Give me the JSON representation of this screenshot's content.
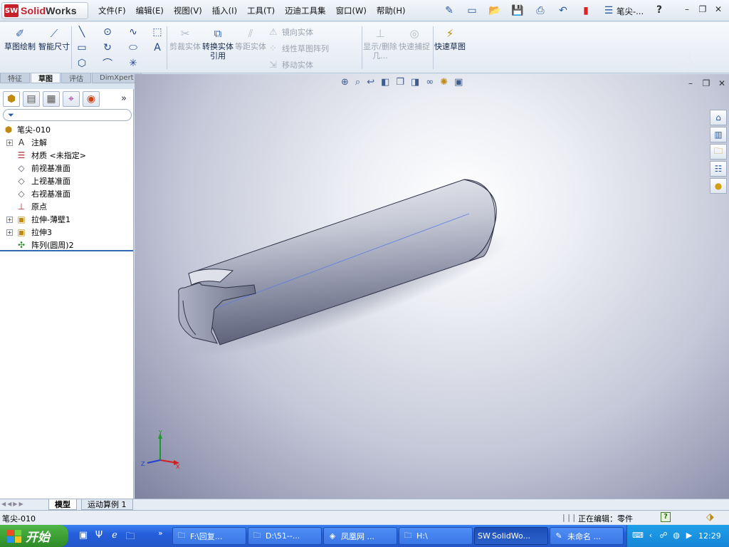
{
  "app": {
    "brand_prefix": "Solid",
    "brand_suffix": "Works",
    "logo_badge": "SW",
    "doc_title": "笔尖-..."
  },
  "menus": [
    "文件(F)",
    "编辑(E)",
    "视图(V)",
    "插入(I)",
    "工具(T)",
    "迈迪工具集",
    "窗口(W)",
    "帮助(H)"
  ],
  "commands": {
    "sketch": "草图绘制",
    "smart_dim": "智能尺寸",
    "trim": "剪裁实体",
    "convert": "转换实体引用",
    "offset": "等距实体",
    "mirror": "镜向实体",
    "linear_pattern": "线性草图阵列",
    "move": "移动实体",
    "show_delete": "显示/删除几...",
    "quick_snap": "快速捕捉",
    "rapid_sketch": "快速草图"
  },
  "cmd_tabs": [
    "特征",
    "草图",
    "评估",
    "DimXpert"
  ],
  "feature_tree": [
    {
      "label": "笔尖-010",
      "icon": "part-icon",
      "root": true,
      "exp": false
    },
    {
      "label": "注解",
      "icon": "annotation-icon",
      "exp": true
    },
    {
      "label": "材质 <未指定>",
      "icon": "material-icon",
      "exp": false
    },
    {
      "label": "前视基准面",
      "icon": "plane-icon",
      "exp": false
    },
    {
      "label": "上视基准面",
      "icon": "plane-icon",
      "exp": false
    },
    {
      "label": "右视基准面",
      "icon": "plane-icon",
      "exp": false
    },
    {
      "label": "原点",
      "icon": "origin-icon",
      "exp": false
    },
    {
      "label": "拉伸-薄壁1",
      "icon": "extrude-icon",
      "exp": true
    },
    {
      "label": "拉伸3",
      "icon": "extrude-icon",
      "exp": true
    },
    {
      "label": "阵列(圆周)2",
      "icon": "pattern-icon",
      "exp": false
    }
  ],
  "bottom_tabs": [
    "模型",
    "运动算例 1"
  ],
  "status": {
    "left": "笔尖-010",
    "separator": "| | |",
    "mode": "正在编辑：零件",
    "help": "?"
  },
  "taskbar": {
    "start": "开始",
    "tasks": [
      {
        "label": "F:\\回复...",
        "icon": "folder-icon"
      },
      {
        "label": "D:\\51--...",
        "icon": "folder-icon"
      },
      {
        "label": "凤凰网 ...",
        "icon": "browser-icon"
      },
      {
        "label": "H:\\",
        "icon": "folder-icon"
      },
      {
        "label": "SolidWo...",
        "icon": "solidworks-icon"
      },
      {
        "label": "未命名 ...",
        "icon": "paint-icon"
      }
    ],
    "clock": "12:29"
  },
  "triad": {
    "x": "X",
    "y": "Y",
    "z": "Z"
  },
  "colors": {
    "accent": "#3566b0",
    "taskbar": "#245edb",
    "start": "#3a9d33",
    "brand_red": "#c8202b"
  }
}
